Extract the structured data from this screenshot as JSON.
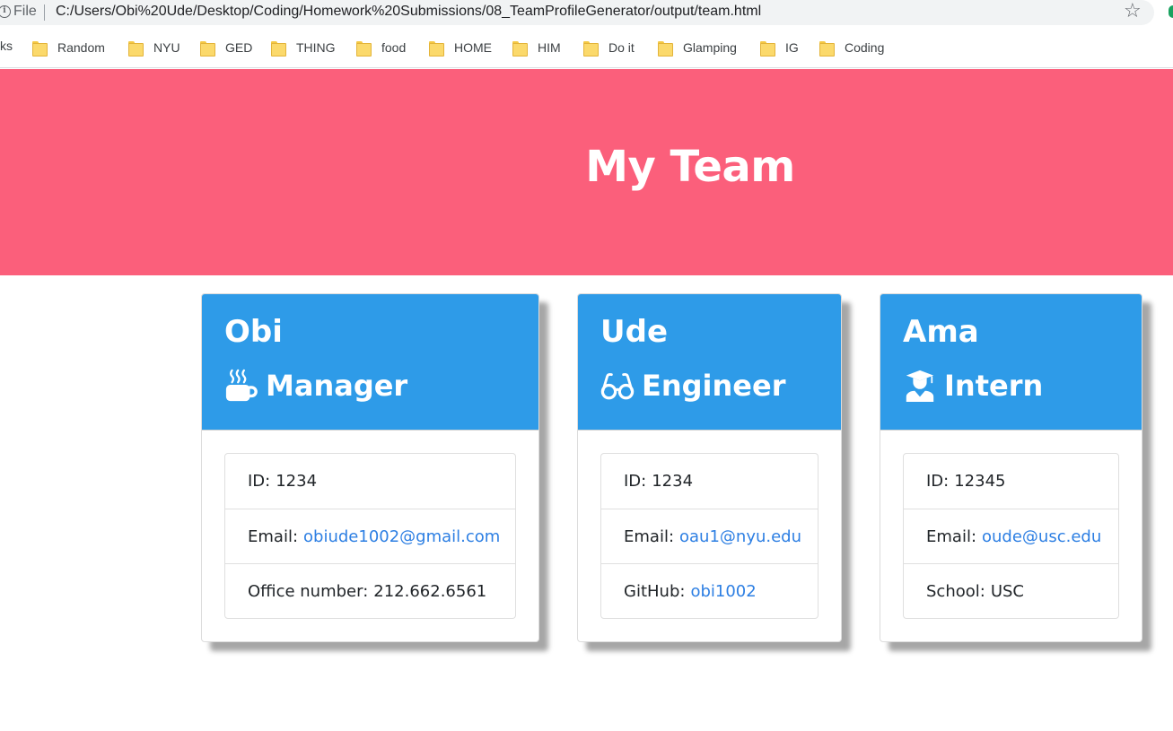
{
  "browser": {
    "file_label": "File",
    "url": "C:/Users/Obi%20Ude/Desktop/Coding/Homework%20Submissions/08_TeamProfileGenerator/output/team.html",
    "bookmarks_lead": "ks",
    "bookmarks": [
      "Random",
      "NYU",
      "GED",
      "THING",
      "food",
      "HOME",
      "HIM",
      "Do it",
      "Glamping",
      "IG",
      "Coding"
    ]
  },
  "page": {
    "title": "My Team",
    "header_color": "#fb5f7b",
    "card_header_color": "#2e9be8",
    "link_color": "#2d7fe3"
  },
  "cards": [
    {
      "name": "Obi",
      "role": "Manager",
      "role_icon": "mug-icon",
      "rows": [
        {
          "label": "ID:",
          "value": "1234"
        },
        {
          "label": "Email:",
          "value": "obiude1002@gmail.com"
        },
        {
          "label": "Office number:",
          "value": "212.662.6561"
        }
      ]
    },
    {
      "name": "Ude",
      "role": "Engineer",
      "role_icon": "glasses-icon",
      "rows": [
        {
          "label": "ID:",
          "value": "1234"
        },
        {
          "label": "Email:",
          "value": "oau1@nyu.edu"
        },
        {
          "label": "GitHub:",
          "value": "obi1002"
        }
      ]
    },
    {
      "name": "Ama",
      "role": "Intern",
      "role_icon": "graduate-icon",
      "rows": [
        {
          "label": "ID:",
          "value": "12345"
        },
        {
          "label": "Email:",
          "value": "oude@usc.edu"
        },
        {
          "label": "School:",
          "value": "USC"
        }
      ]
    }
  ]
}
